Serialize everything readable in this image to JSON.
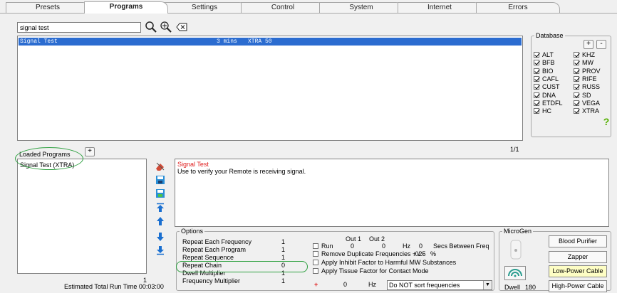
{
  "tabs": [
    {
      "label": "Presets"
    },
    {
      "label": "Programs"
    },
    {
      "label": "Settings"
    },
    {
      "label": "Control"
    },
    {
      "label": "System"
    },
    {
      "label": "Internet"
    },
    {
      "label": "Errors"
    }
  ],
  "active_tab": "Programs",
  "search": {
    "value": "signal test"
  },
  "programs": [
    {
      "name": "Signal Test",
      "duration": "3 mins",
      "database": "XTRA 50"
    }
  ],
  "database": {
    "title": "Database",
    "add_label": "+",
    "remove_label": "-",
    "items_left": [
      {
        "label": "ALT",
        "checked": true
      },
      {
        "label": "BFB",
        "checked": true
      },
      {
        "label": "BIO",
        "checked": true
      },
      {
        "label": "CAFL",
        "checked": true
      },
      {
        "label": "CUST",
        "checked": true
      },
      {
        "label": "DNA",
        "checked": true
      },
      {
        "label": "ETDFL",
        "checked": true
      },
      {
        "label": "HC",
        "checked": true
      }
    ],
    "items_right": [
      {
        "label": "KHZ",
        "checked": true
      },
      {
        "label": "MW",
        "checked": true
      },
      {
        "label": "PROV",
        "checked": true
      },
      {
        "label": "RIFE",
        "checked": true
      },
      {
        "label": "RUSS",
        "checked": true
      },
      {
        "label": "SD",
        "checked": true
      },
      {
        "label": "VEGA",
        "checked": true
      },
      {
        "label": "XTRA",
        "checked": true
      }
    ],
    "help_label": "?"
  },
  "page_indicator": "1/1",
  "loaded_programs": {
    "title": "Loaded Programs",
    "add_label": "+",
    "items": [
      "Signal Test (XTRA)"
    ],
    "count": "1",
    "estimated_label": "Estimated Total Run Time 00:03:00"
  },
  "description": {
    "title": "Signal Test",
    "text": "Use to verify your Remote is receiving signal."
  },
  "options": {
    "title": "Options",
    "rows": [
      {
        "label": "Repeat Each Frequency",
        "value": "1"
      },
      {
        "label": "Repeat Each Program",
        "value": "1"
      },
      {
        "label": "Repeat Sequence",
        "value": "1"
      },
      {
        "label": "Repeat Chain",
        "value": "0"
      },
      {
        "label": "Dwell Multiplier",
        "value": "1"
      },
      {
        "label": "Frequency Multiplier",
        "value": "1"
      }
    ],
    "out1_label": "Out 1",
    "out2_label": "Out 2",
    "run_label": "Run",
    "out1_value": "0",
    "out2_value": "0",
    "hz_label": "Hz",
    "secs_value": "0",
    "secs_label": "Secs Between Freq",
    "remove_dup_label": "Remove Duplicate Frequencies + / -",
    "remove_dup_value": ".025",
    "percent_label": "%",
    "inhibit_label": "Apply Inhibit Factor to Harmful MW Substances",
    "tissue_label": "Apply Tissue Factor for Contact Mode",
    "plus_label": "+",
    "offset_value": "0",
    "offset_unit": "Hz",
    "sort_selected": "Do NOT sort frequencies"
  },
  "microgen": {
    "title": "MicroGen",
    "buttons": [
      "Blood Purifier",
      "Zapper",
      "Low-Power Cable",
      "High-Power Cable"
    ],
    "dwell_label": "Dwell",
    "dwell_value": "180"
  }
}
